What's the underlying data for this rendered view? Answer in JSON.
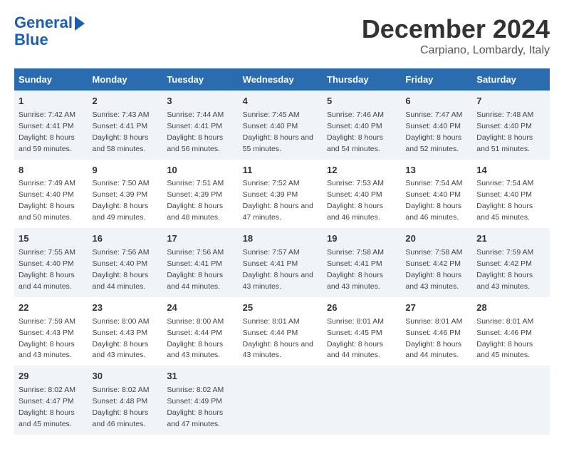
{
  "logo": {
    "line1": "General",
    "line2": "Blue"
  },
  "title": "December 2024",
  "location": "Carpiano, Lombardy, Italy",
  "days_of_week": [
    "Sunday",
    "Monday",
    "Tuesday",
    "Wednesday",
    "Thursday",
    "Friday",
    "Saturday"
  ],
  "weeks": [
    [
      {
        "day": "1",
        "sunrise": "Sunrise: 7:42 AM",
        "sunset": "Sunset: 4:41 PM",
        "daylight": "Daylight: 8 hours and 59 minutes."
      },
      {
        "day": "2",
        "sunrise": "Sunrise: 7:43 AM",
        "sunset": "Sunset: 4:41 PM",
        "daylight": "Daylight: 8 hours and 58 minutes."
      },
      {
        "day": "3",
        "sunrise": "Sunrise: 7:44 AM",
        "sunset": "Sunset: 4:41 PM",
        "daylight": "Daylight: 8 hours and 56 minutes."
      },
      {
        "day": "4",
        "sunrise": "Sunrise: 7:45 AM",
        "sunset": "Sunset: 4:40 PM",
        "daylight": "Daylight: 8 hours and 55 minutes."
      },
      {
        "day": "5",
        "sunrise": "Sunrise: 7:46 AM",
        "sunset": "Sunset: 4:40 PM",
        "daylight": "Daylight: 8 hours and 54 minutes."
      },
      {
        "day": "6",
        "sunrise": "Sunrise: 7:47 AM",
        "sunset": "Sunset: 4:40 PM",
        "daylight": "Daylight: 8 hours and 52 minutes."
      },
      {
        "day": "7",
        "sunrise": "Sunrise: 7:48 AM",
        "sunset": "Sunset: 4:40 PM",
        "daylight": "Daylight: 8 hours and 51 minutes."
      }
    ],
    [
      {
        "day": "8",
        "sunrise": "Sunrise: 7:49 AM",
        "sunset": "Sunset: 4:40 PM",
        "daylight": "Daylight: 8 hours and 50 minutes."
      },
      {
        "day": "9",
        "sunrise": "Sunrise: 7:50 AM",
        "sunset": "Sunset: 4:39 PM",
        "daylight": "Daylight: 8 hours and 49 minutes."
      },
      {
        "day": "10",
        "sunrise": "Sunrise: 7:51 AM",
        "sunset": "Sunset: 4:39 PM",
        "daylight": "Daylight: 8 hours and 48 minutes."
      },
      {
        "day": "11",
        "sunrise": "Sunrise: 7:52 AM",
        "sunset": "Sunset: 4:39 PM",
        "daylight": "Daylight: 8 hours and 47 minutes."
      },
      {
        "day": "12",
        "sunrise": "Sunrise: 7:53 AM",
        "sunset": "Sunset: 4:40 PM",
        "daylight": "Daylight: 8 hours and 46 minutes."
      },
      {
        "day": "13",
        "sunrise": "Sunrise: 7:54 AM",
        "sunset": "Sunset: 4:40 PM",
        "daylight": "Daylight: 8 hours and 46 minutes."
      },
      {
        "day": "14",
        "sunrise": "Sunrise: 7:54 AM",
        "sunset": "Sunset: 4:40 PM",
        "daylight": "Daylight: 8 hours and 45 minutes."
      }
    ],
    [
      {
        "day": "15",
        "sunrise": "Sunrise: 7:55 AM",
        "sunset": "Sunset: 4:40 PM",
        "daylight": "Daylight: 8 hours and 44 minutes."
      },
      {
        "day": "16",
        "sunrise": "Sunrise: 7:56 AM",
        "sunset": "Sunset: 4:40 PM",
        "daylight": "Daylight: 8 hours and 44 minutes."
      },
      {
        "day": "17",
        "sunrise": "Sunrise: 7:56 AM",
        "sunset": "Sunset: 4:41 PM",
        "daylight": "Daylight: 8 hours and 44 minutes."
      },
      {
        "day": "18",
        "sunrise": "Sunrise: 7:57 AM",
        "sunset": "Sunset: 4:41 PM",
        "daylight": "Daylight: 8 hours and 43 minutes."
      },
      {
        "day": "19",
        "sunrise": "Sunrise: 7:58 AM",
        "sunset": "Sunset: 4:41 PM",
        "daylight": "Daylight: 8 hours and 43 minutes."
      },
      {
        "day": "20",
        "sunrise": "Sunrise: 7:58 AM",
        "sunset": "Sunset: 4:42 PM",
        "daylight": "Daylight: 8 hours and 43 minutes."
      },
      {
        "day": "21",
        "sunrise": "Sunrise: 7:59 AM",
        "sunset": "Sunset: 4:42 PM",
        "daylight": "Daylight: 8 hours and 43 minutes."
      }
    ],
    [
      {
        "day": "22",
        "sunrise": "Sunrise: 7:59 AM",
        "sunset": "Sunset: 4:43 PM",
        "daylight": "Daylight: 8 hours and 43 minutes."
      },
      {
        "day": "23",
        "sunrise": "Sunrise: 8:00 AM",
        "sunset": "Sunset: 4:43 PM",
        "daylight": "Daylight: 8 hours and 43 minutes."
      },
      {
        "day": "24",
        "sunrise": "Sunrise: 8:00 AM",
        "sunset": "Sunset: 4:44 PM",
        "daylight": "Daylight: 8 hours and 43 minutes."
      },
      {
        "day": "25",
        "sunrise": "Sunrise: 8:01 AM",
        "sunset": "Sunset: 4:44 PM",
        "daylight": "Daylight: 8 hours and 43 minutes."
      },
      {
        "day": "26",
        "sunrise": "Sunrise: 8:01 AM",
        "sunset": "Sunset: 4:45 PM",
        "daylight": "Daylight: 8 hours and 44 minutes."
      },
      {
        "day": "27",
        "sunrise": "Sunrise: 8:01 AM",
        "sunset": "Sunset: 4:46 PM",
        "daylight": "Daylight: 8 hours and 44 minutes."
      },
      {
        "day": "28",
        "sunrise": "Sunrise: 8:01 AM",
        "sunset": "Sunset: 4:46 PM",
        "daylight": "Daylight: 8 hours and 45 minutes."
      }
    ],
    [
      {
        "day": "29",
        "sunrise": "Sunrise: 8:02 AM",
        "sunset": "Sunset: 4:47 PM",
        "daylight": "Daylight: 8 hours and 45 minutes."
      },
      {
        "day": "30",
        "sunrise": "Sunrise: 8:02 AM",
        "sunset": "Sunset: 4:48 PM",
        "daylight": "Daylight: 8 hours and 46 minutes."
      },
      {
        "day": "31",
        "sunrise": "Sunrise: 8:02 AM",
        "sunset": "Sunset: 4:49 PM",
        "daylight": "Daylight: 8 hours and 47 minutes."
      },
      null,
      null,
      null,
      null
    ]
  ]
}
